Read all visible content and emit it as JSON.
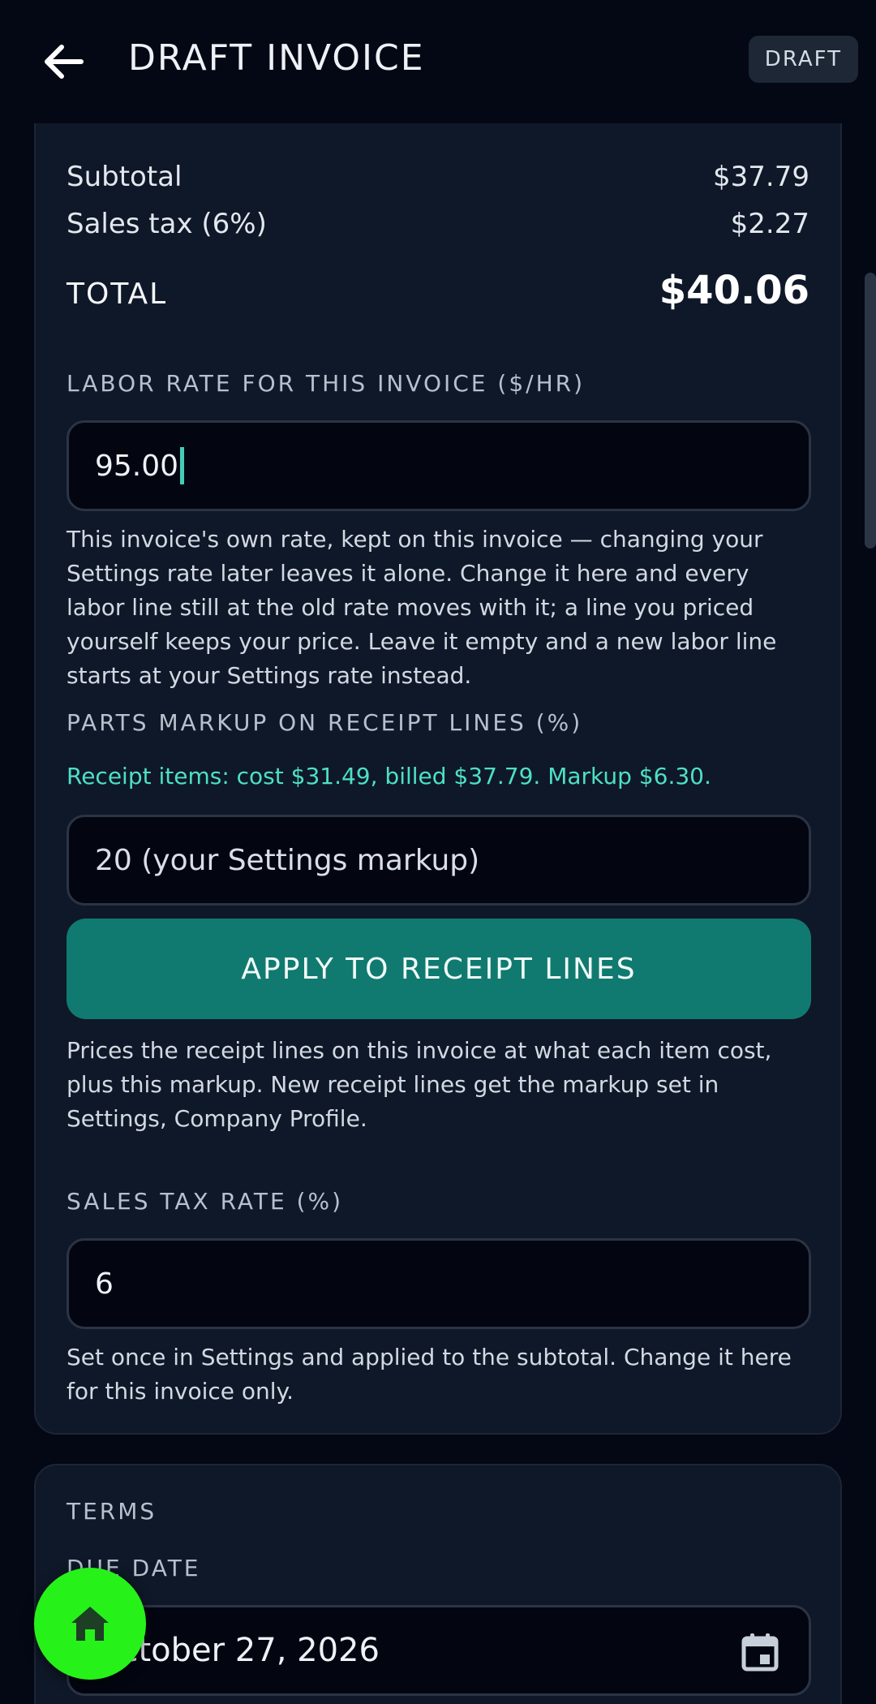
{
  "header": {
    "title": "DRAFT INVOICE",
    "badge": "DRAFT",
    "back_icon": "arrow-left-icon"
  },
  "totals": {
    "subtotal_label": "Subtotal",
    "subtotal_value": "$37.79",
    "tax_label": "Sales tax (6%)",
    "tax_value": "$2.27",
    "total_label": "TOTAL",
    "total_value": "$40.06"
  },
  "labor": {
    "label": "LABOR RATE FOR THIS INVOICE ($/HR)",
    "value": "95.00",
    "help": "This invoice's own rate, kept on this invoice — changing your Settings rate later leaves it alone. Change it here and every labor line still at the old rate moves with it; a line you priced yourself keeps your price. Leave it empty and a new labor line starts at your Settings rate instead."
  },
  "markup": {
    "label": "PARTS MARKUP ON RECEIPT LINES (%)",
    "info": "Receipt items: cost $31.49, billed $37.79. Markup $6.30.",
    "placeholder": "20 (your Settings markup)",
    "apply_button": "APPLY TO RECEIPT LINES",
    "help": "Prices the receipt lines on this invoice at what each item cost, plus this markup. New receipt lines get the markup set in Settings, Company Profile."
  },
  "tax": {
    "label": "SALES TAX RATE (%)",
    "value": "6",
    "help": "Set once in Settings and applied to the subtotal. Change it here for this invoice only."
  },
  "terms": {
    "title": "TERMS",
    "due_date_label": "DUE DATE",
    "due_date_value": "October 27, 2026",
    "calendar_icon": "calendar-icon"
  },
  "fab": {
    "icon": "home-icon"
  },
  "colors": {
    "background": "#040814",
    "card": "#0f1828",
    "accent": "#107a70",
    "info_green": "#4de0c4",
    "fab": "#26f21a"
  }
}
